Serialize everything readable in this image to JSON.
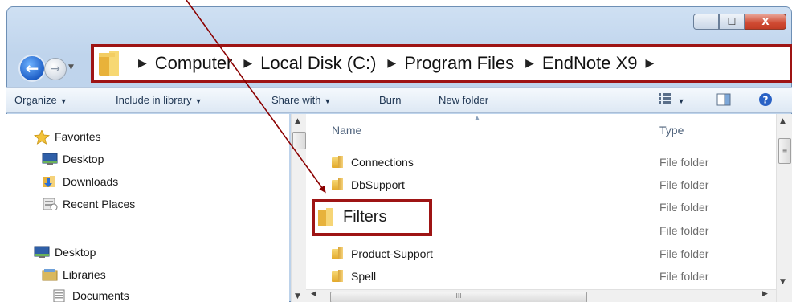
{
  "window": {
    "minimize": "—",
    "maximize": "☐",
    "close": "X"
  },
  "nav": {
    "back": "←",
    "forward": "→",
    "recent": "▼"
  },
  "address": {
    "separator": "▶",
    "crumbs": [
      "Computer",
      "Local Disk (C:)",
      "Program Files",
      "EndNote X9"
    ]
  },
  "toolbar": {
    "organize": "Organize",
    "include_in_library": "Include in library",
    "share_with": "Share with",
    "burn": "Burn",
    "new_folder": "New folder",
    "dropdown": "▼"
  },
  "nav_pane": {
    "favorites": "Favorites",
    "desktop": "Desktop",
    "downloads": "Downloads",
    "recent_places": "Recent Places",
    "desktop2": "Desktop",
    "libraries": "Libraries",
    "documents": "Documents"
  },
  "content": {
    "columns": {
      "name": "Name",
      "type": "Type"
    },
    "rows": [
      {
        "name": "Connections",
        "type": "File folder"
      },
      {
        "name": "DbSupport",
        "type": "File folder"
      },
      {
        "name": "Filters",
        "type": "File folder"
      },
      {
        "name": "",
        "type": "File folder"
      },
      {
        "name": "Product-Support",
        "type": "File folder"
      },
      {
        "name": "Spell",
        "type": "File folder"
      }
    ]
  },
  "colors": {
    "highlight": "#9e1414",
    "arrow": "#8b0000"
  }
}
